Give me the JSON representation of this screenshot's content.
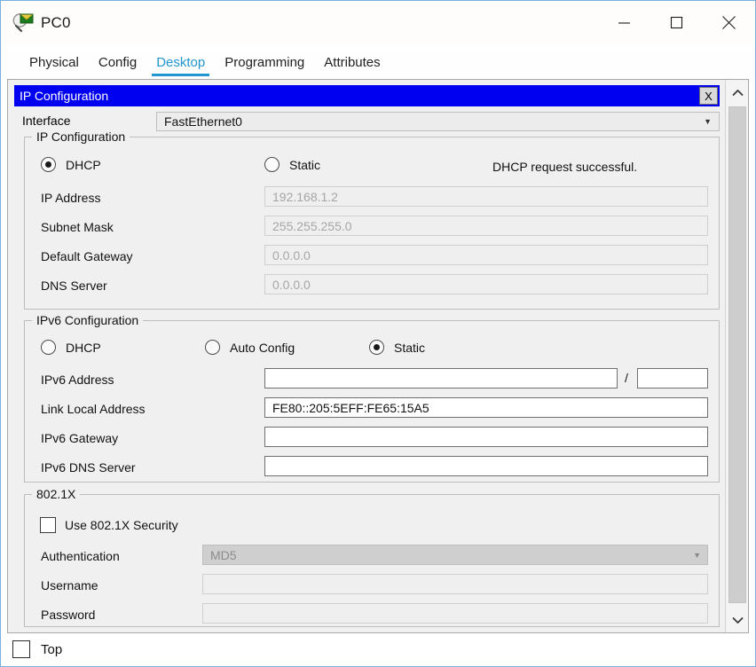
{
  "window": {
    "title": "PC0",
    "icon": "packet-tracer-inspect-icon",
    "controls": {
      "minimize": "Minimize",
      "maximize": "Maximize",
      "close": "Close"
    }
  },
  "tabs": [
    {
      "label": "Physical",
      "active": false
    },
    {
      "label": "Config",
      "active": false
    },
    {
      "label": "Desktop",
      "active": true
    },
    {
      "label": "Programming",
      "active": false
    },
    {
      "label": "Attributes",
      "active": false
    }
  ],
  "dialog": {
    "title": "IP Configuration",
    "close_label": "X",
    "titlebar_color": "#0000f0",
    "accent_color": "#2196cf"
  },
  "interface": {
    "label": "Interface",
    "value": "FastEthernet0",
    "arrow": "▼"
  },
  "ipv4": {
    "group_title": "IP Configuration",
    "mode": "DHCP",
    "options": [
      {
        "label": "DHCP",
        "selected": true
      },
      {
        "label": "Static",
        "selected": false
      }
    ],
    "status": "DHCP request successful.",
    "fields": [
      {
        "label": "IP Address",
        "value": "192.168.1.2",
        "enabled": false
      },
      {
        "label": "Subnet Mask",
        "value": "255.255.255.0",
        "enabled": false
      },
      {
        "label": "Default Gateway",
        "value": "0.0.0.0",
        "enabled": false
      },
      {
        "label": "DNS Server",
        "value": "0.0.0.0",
        "enabled": false
      }
    ]
  },
  "ipv6": {
    "group_title": "IPv6 Configuration",
    "mode": "Static",
    "options": [
      {
        "label": "DHCP",
        "selected": false
      },
      {
        "label": "Auto Config",
        "selected": false
      },
      {
        "label": "Static",
        "selected": true
      }
    ],
    "separator": "/",
    "fields": [
      {
        "label": "IPv6 Address",
        "value": "",
        "prefix": "",
        "enabled": true
      },
      {
        "label": "Link Local Address",
        "value": "FE80::205:5EFF:FE65:15A5",
        "enabled": true
      },
      {
        "label": "IPv6 Gateway",
        "value": "",
        "enabled": true
      },
      {
        "label": "IPv6 DNS Server",
        "value": "",
        "enabled": true
      }
    ]
  },
  "dot1x": {
    "group_title": "802.1X",
    "use_security": {
      "label": "Use 802.1X Security",
      "checked": false
    },
    "authentication": {
      "label": "Authentication",
      "value": "MD5",
      "arrow": "▼",
      "enabled": false
    },
    "username": {
      "label": "Username",
      "value": "",
      "enabled": false
    },
    "password": {
      "label": "Password",
      "value": "",
      "enabled": false
    }
  },
  "bottom": {
    "top_checkbox": {
      "label": "Top",
      "checked": false
    }
  },
  "scrollbar": {
    "up_arrow": "▲",
    "down_arrow": "▼"
  }
}
